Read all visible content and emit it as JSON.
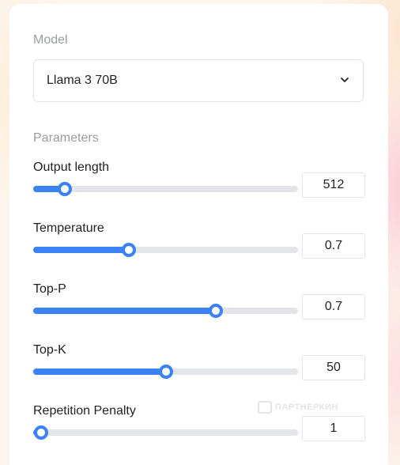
{
  "model": {
    "section_label": "Model",
    "selected": "Llama 3 70B"
  },
  "parameters": {
    "section_label": "Parameters",
    "items": [
      {
        "label": "Output length",
        "value": "512",
        "level_pct": 12
      },
      {
        "label": "Temperature",
        "value": "0.7",
        "level_pct": 36
      },
      {
        "label": "Top-P",
        "value": "0.7",
        "level_pct": 69
      },
      {
        "label": "Top-K",
        "value": "50",
        "level_pct": 50
      },
      {
        "label": "Repetition Penalty",
        "value": "1",
        "level_pct": 3
      }
    ]
  },
  "watermark": {
    "text": "ПАРТНЕРКИН"
  },
  "colors": {
    "accent": "#3b82f6",
    "track": "#e4e5e9",
    "label_muted": "#9a9ca3",
    "text": "#1f2024"
  },
  "icons": {
    "select": "chevron-down-icon",
    "watermark": "chat-bubble-icon"
  }
}
